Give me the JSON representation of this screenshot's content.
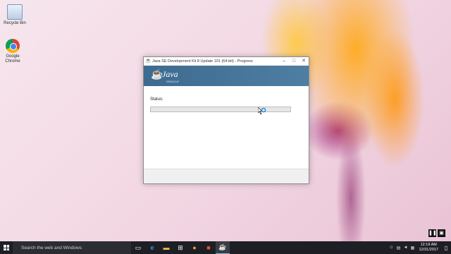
{
  "desktop": {
    "icons": [
      {
        "name": "recycle-bin",
        "label": "Recycle Bin"
      },
      {
        "name": "google-chrome",
        "label": "Google Chrome"
      }
    ]
  },
  "installer": {
    "title": "Java SE Development Kit 8 Update 101 (64-bit) - Progress",
    "brand": "Java",
    "vendor": "ORACLE",
    "status_label": "Status:",
    "status_value": "",
    "progress": 0,
    "buttons": {
      "minimize": "–",
      "maximize": "□",
      "close": "✕"
    }
  },
  "taskbar": {
    "search_placeholder": "Search the web and Windows",
    "apps": [
      "task-view",
      "edge",
      "file-explorer",
      "store",
      "chrome",
      "office",
      "java-installer"
    ],
    "clock_time": "12:19 AM",
    "clock_date": "12/31/2017"
  },
  "colors": {
    "banner": "#3d6b8f",
    "taskbar": "#1d1f24",
    "progress_fill": "#06b025"
  }
}
